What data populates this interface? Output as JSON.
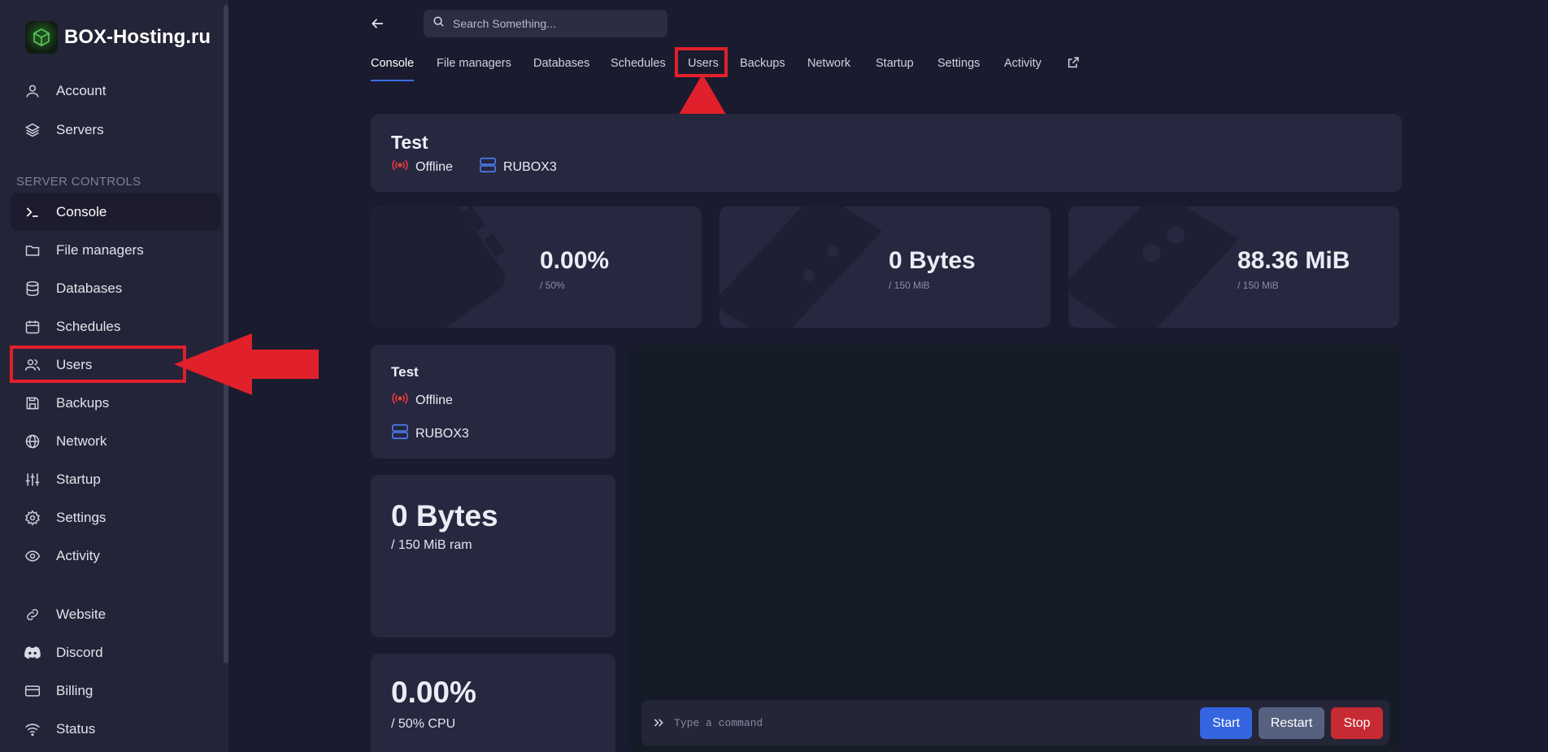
{
  "brand": {
    "title": "BOX-Hosting.ru"
  },
  "sidebar": {
    "top_items": [
      {
        "label": "Account",
        "icon": "user-icon"
      },
      {
        "label": "Servers",
        "icon": "layers-icon"
      }
    ],
    "section_label": "SERVER CONTROLS",
    "control_items": [
      {
        "label": "Console",
        "icon": "terminal-icon",
        "active": true
      },
      {
        "label": "File managers",
        "icon": "folder-icon"
      },
      {
        "label": "Databases",
        "icon": "database-icon"
      },
      {
        "label": "Schedules",
        "icon": "calendar-icon"
      },
      {
        "label": "Users",
        "icon": "users-icon",
        "highlighted": true
      },
      {
        "label": "Backups",
        "icon": "save-icon"
      },
      {
        "label": "Network",
        "icon": "globe-icon"
      },
      {
        "label": "Startup",
        "icon": "sliders-icon"
      },
      {
        "label": "Settings",
        "icon": "gear-icon"
      },
      {
        "label": "Activity",
        "icon": "eye-icon"
      }
    ],
    "link_items": [
      {
        "label": "Website",
        "icon": "link-icon"
      },
      {
        "label": "Discord",
        "icon": "discord-icon"
      },
      {
        "label": "Billing",
        "icon": "credit-card-icon"
      },
      {
        "label": "Status",
        "icon": "wifi-icon"
      }
    ]
  },
  "search": {
    "placeholder": "Search Something..."
  },
  "tabs": [
    {
      "label": "Console",
      "active": true
    },
    {
      "label": "File managers"
    },
    {
      "label": "Databases"
    },
    {
      "label": "Schedules"
    },
    {
      "label": "Users",
      "highlighted": true
    },
    {
      "label": "Backups"
    },
    {
      "label": "Network"
    },
    {
      "label": "Startup"
    },
    {
      "label": "Settings"
    },
    {
      "label": "Activity"
    }
  ],
  "server": {
    "name": "Test",
    "status": "Offline",
    "node": "RUBOX3"
  },
  "stats": [
    {
      "value": "0.00%",
      "limit": "/ 50%",
      "icon": "cpu-icon"
    },
    {
      "value": "0 Bytes",
      "limit": "/ 150 MiB",
      "icon": "memory-icon"
    },
    {
      "value": "88.36 MiB",
      "limit": "/ 150 MiB",
      "icon": "disk-icon"
    }
  ],
  "details": {
    "name": "Test",
    "status": "Offline",
    "node": "RUBOX3",
    "memory_value": "0 Bytes",
    "memory_sub": "/ 150 MiB ram",
    "cpu_value": "0.00%",
    "cpu_sub": "/ 50% CPU"
  },
  "console": {
    "placeholder": "Type a command",
    "start_label": "Start",
    "restart_label": "Restart",
    "stop_label": "Stop"
  },
  "colors": {
    "accent": "#3b6ee8",
    "offline": "#e23b3b",
    "node_icon": "#4a7bf0",
    "annotation": "#e0202a",
    "start": "#3464e0",
    "restart": "#566180",
    "stop": "#c62a33"
  }
}
